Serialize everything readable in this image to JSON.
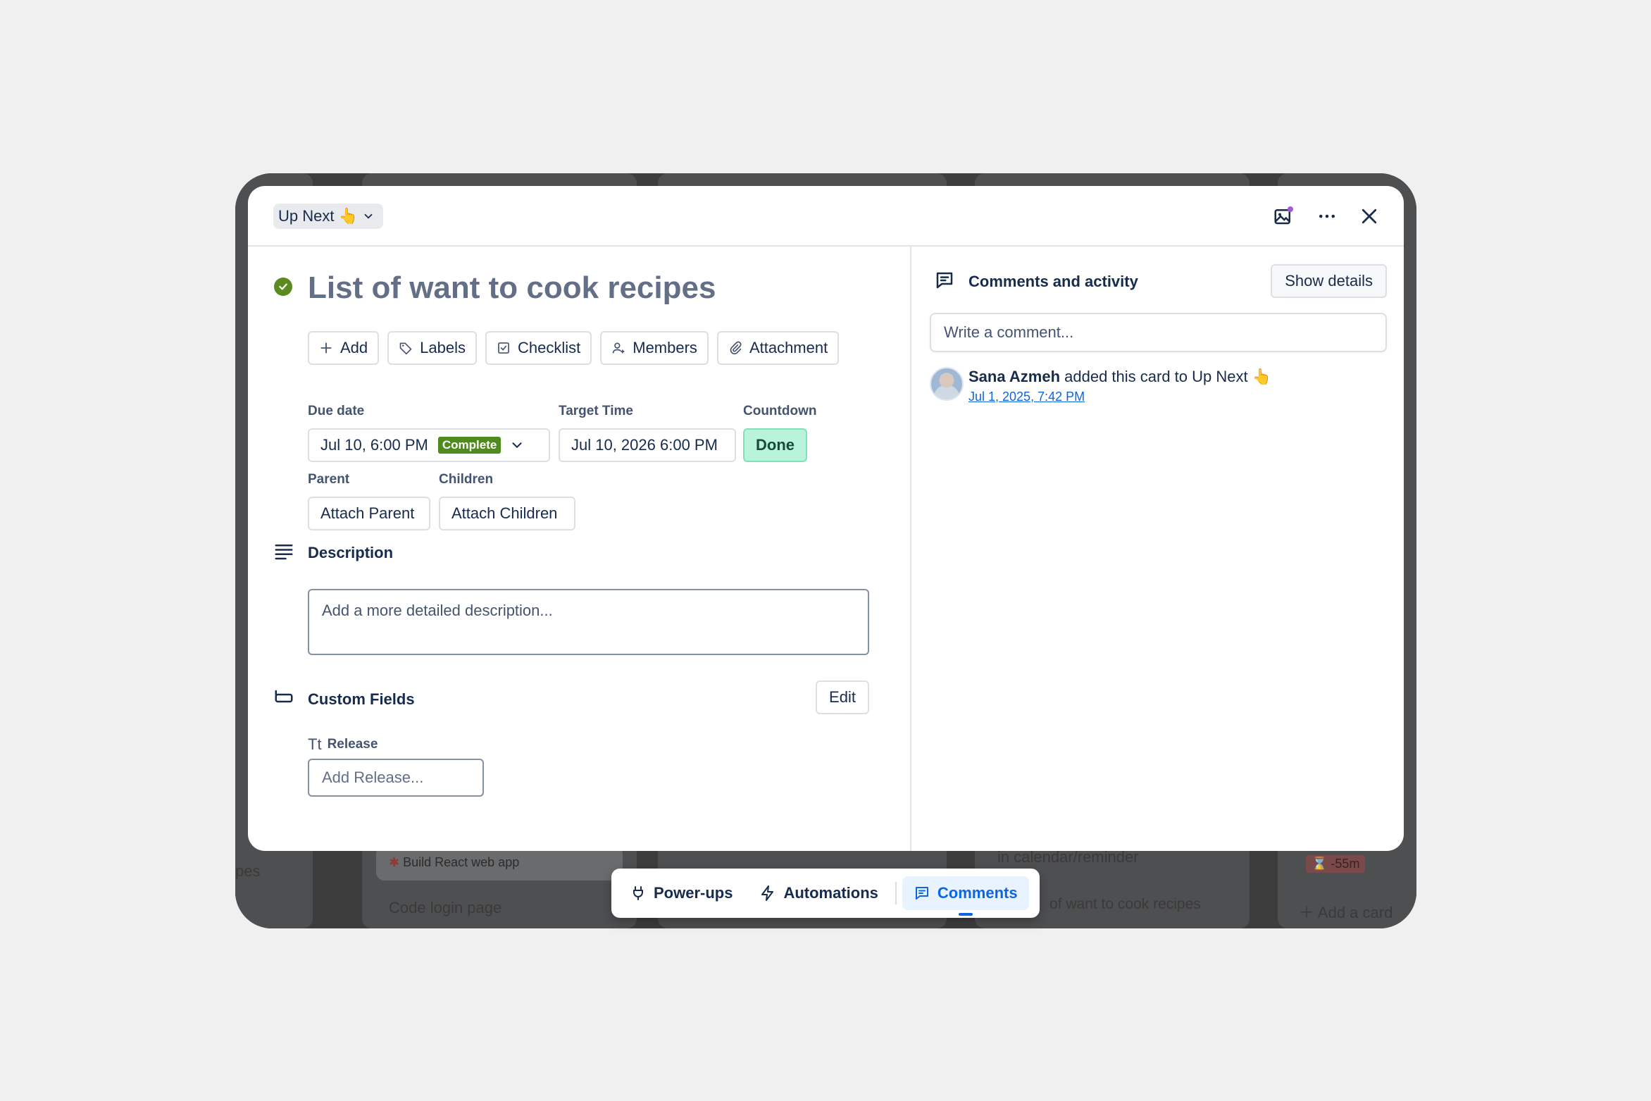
{
  "card": {
    "list_name": "Up Next 👆",
    "title": "List of want to cook recipes",
    "actions": [
      {
        "label": "Add",
        "icon": "plus-icon"
      },
      {
        "label": "Labels",
        "icon": "tag-icon"
      },
      {
        "label": "Checklist",
        "icon": "checkbox-icon"
      },
      {
        "label": "Members",
        "icon": "user-plus-icon"
      },
      {
        "label": "Attachment",
        "icon": "paperclip-icon"
      }
    ],
    "due_date": {
      "label": "Due date",
      "value": "Jul 10, 6:00 PM",
      "status": "Complete"
    },
    "target_time": {
      "label": "Target Time",
      "value": "Jul 10, 2026 6:00 PM"
    },
    "countdown": {
      "label": "Countdown",
      "value": "Done"
    },
    "parent": {
      "label": "Parent",
      "button": "Attach Parent"
    },
    "children": {
      "label": "Children",
      "button": "Attach Children"
    },
    "description": {
      "heading": "Description",
      "placeholder": "Add a more detailed description..."
    },
    "custom_fields": {
      "heading": "Custom Fields",
      "edit_label": "Edit",
      "field_name": "Release",
      "field_placeholder": "Add Release..."
    }
  },
  "comments": {
    "heading": "Comments and activity",
    "show_details": "Show details",
    "input_placeholder": "Write a comment...",
    "activity": {
      "user": "Sana Azmeh",
      "text": "added this card to Up Next 👆",
      "timestamp": "Jul 1, 2025, 7:42 PM"
    }
  },
  "toolbar": {
    "powerups": "Power-ups",
    "automations": "Automations",
    "comments": "Comments"
  },
  "background": {
    "card_build": "Build React web app",
    "card_login": "Code login page",
    "card_calendar": "in calendar/reminder",
    "card_recipes": "of want to cook recipes",
    "add_card": "Add a card",
    "timer_badge": "-55m",
    "partial_pes": "pes"
  },
  "colors": {
    "complete": "#4f8a1d",
    "done_bg": "#baf3db",
    "accent": "#0c66e4",
    "check": "#5b8b1e"
  }
}
